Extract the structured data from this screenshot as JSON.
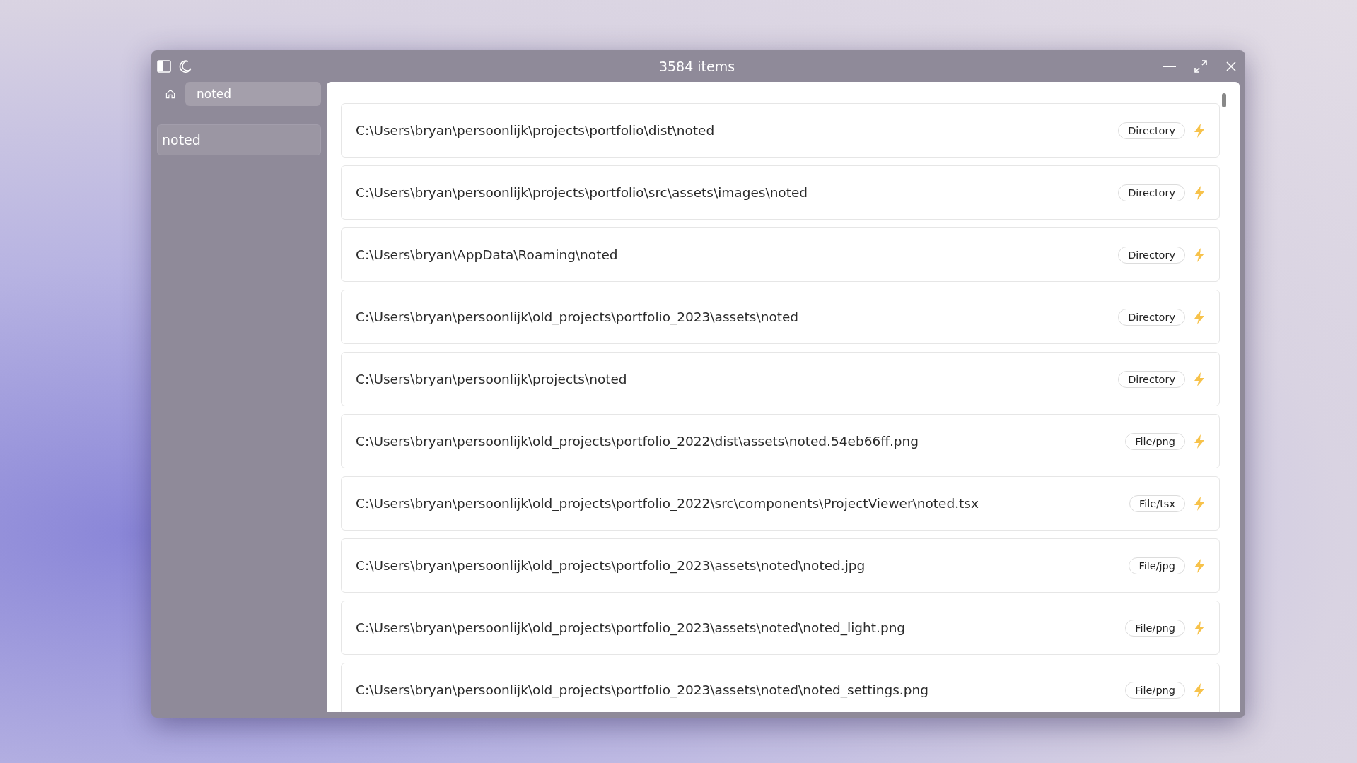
{
  "window": {
    "title": "3584 items"
  },
  "sidebar": {
    "search": {
      "value": "noted"
    },
    "items": [
      {
        "label": "noted",
        "selected": true
      }
    ]
  },
  "results": [
    {
      "path": "C:\\Users\\bryan\\persoonlijk\\projects\\portfolio\\dist\\noted",
      "type": "Directory"
    },
    {
      "path": "C:\\Users\\bryan\\persoonlijk\\projects\\portfolio\\src\\assets\\images\\noted",
      "type": "Directory"
    },
    {
      "path": "C:\\Users\\bryan\\AppData\\Roaming\\noted",
      "type": "Directory"
    },
    {
      "path": "C:\\Users\\bryan\\persoonlijk\\old_projects\\portfolio_2023\\assets\\noted",
      "type": "Directory"
    },
    {
      "path": "C:\\Users\\bryan\\persoonlijk\\projects\\noted",
      "type": "Directory"
    },
    {
      "path": "C:\\Users\\bryan\\persoonlijk\\old_projects\\portfolio_2022\\dist\\assets\\noted.54eb66ff.png",
      "type": "File/png"
    },
    {
      "path": "C:\\Users\\bryan\\persoonlijk\\old_projects\\portfolio_2022\\src\\components\\ProjectViewer\\noted.tsx",
      "type": "File/tsx"
    },
    {
      "path": "C:\\Users\\bryan\\persoonlijk\\old_projects\\portfolio_2023\\assets\\noted\\noted.jpg",
      "type": "File/jpg"
    },
    {
      "path": "C:\\Users\\bryan\\persoonlijk\\old_projects\\portfolio_2023\\assets\\noted\\noted_light.png",
      "type": "File/png"
    },
    {
      "path": "C:\\Users\\bryan\\persoonlijk\\old_projects\\portfolio_2023\\assets\\noted\\noted_settings.png",
      "type": "File/png"
    }
  ]
}
